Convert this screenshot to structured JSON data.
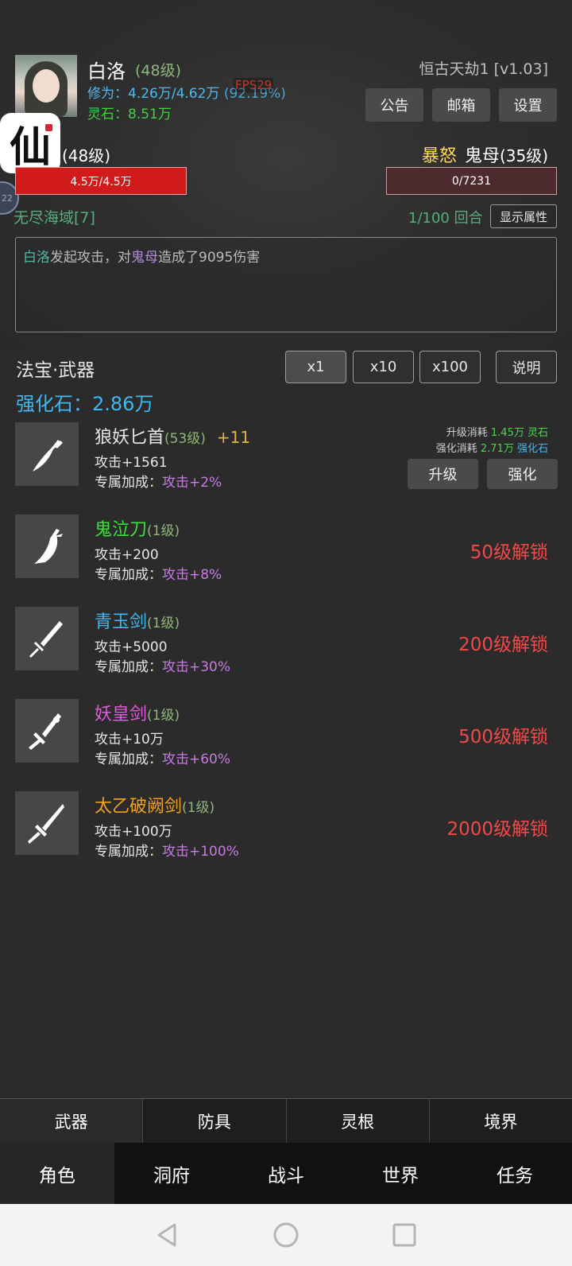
{
  "header": {
    "player_name": "白洛",
    "player_level": "(48级)",
    "cultivation_label": "修为：",
    "cultivation_value": "4.26万/4.62万",
    "cultivation_pct": "(92.19%)",
    "fps": "FPS29",
    "stone_label": "灵石：",
    "stone_value": "8.51万",
    "game_version": "恒古天劫1 [v1.03]",
    "buttons": {
      "announce": "公告",
      "mail": "邮箱",
      "settings": "设置"
    }
  },
  "overlay": {
    "app_logo_char": "仙",
    "side_bubble": "22"
  },
  "battle": {
    "hero_level": "(48级)",
    "hero_hp": "4.5万/4.5万",
    "hero_hp_fraction": 1.0,
    "enemy_status": "暴怒",
    "enemy_name": "鬼母",
    "enemy_level": "(35级)",
    "enemy_hp": "0/7231",
    "enemy_hp_fraction": 0.0,
    "zone": "无尽海域[7]",
    "round": "1/100 回合",
    "show_attr_button": "显示属性",
    "log": {
      "actor": "白洛",
      "text1": "发起攻击，对",
      "target": "鬼母",
      "text2": "造成了9095伤害"
    }
  },
  "section": {
    "title": "法宝·武器",
    "multipliers": [
      "x1",
      "x10",
      "x100"
    ],
    "active_multiplier": "x1",
    "explain_button": "说明",
    "stone_label": "强化石：",
    "stone_value": "2.86万"
  },
  "weapons": [
    {
      "name": "狼妖匕首",
      "level": "(53级)",
      "enhance": "+11",
      "attack": "攻击+1561",
      "bonus_label": "专属加成：",
      "bonus_value": "攻击+2%",
      "name_color": "#e6e6e6",
      "icon": "dagger-icon",
      "upgrade_cost_label": "升级消耗",
      "upgrade_cost": "1.45万",
      "upgrade_unit": "灵石",
      "enhance_cost_label": "强化消耗",
      "enhance_cost": "2.71万",
      "enhance_unit": "强化石",
      "upgrade_button": "升级",
      "enhance_button": "强化"
    },
    {
      "name": "鬼泣刀",
      "level": "(1级)",
      "attack": "攻击+200",
      "bonus_label": "专属加成：",
      "bonus_value": "攻击+8%",
      "unlock": "50级解锁",
      "name_color": "#3ee03e",
      "icon": "saber-icon"
    },
    {
      "name": "青玉剑",
      "level": "(1级)",
      "attack": "攻击+5000",
      "bonus_label": "专属加成：",
      "bonus_value": "攻击+30%",
      "unlock": "200级解锁",
      "name_color": "#3fb7f0",
      "icon": "sword-icon"
    },
    {
      "name": "妖皇剑",
      "level": "(1级)",
      "attack": "攻击+10万",
      "bonus_label": "专属加成：",
      "bonus_value": "攻击+60%",
      "unlock": "500级解锁",
      "name_color": "#e05ad8",
      "icon": "ornate-sword-icon"
    },
    {
      "name": "太乙破阙剑",
      "level": "(1级)",
      "attack": "攻击+100万",
      "bonus_label": "专属加成：",
      "bonus_value": "攻击+100%",
      "unlock": "2000级解锁",
      "name_color": "#f0a020",
      "icon": "long-sword-icon"
    }
  ],
  "subtabs": [
    "武器",
    "防具",
    "灵根",
    "境界"
  ],
  "active_subtab": "武器",
  "maintabs": [
    "角色",
    "洞府",
    "战斗",
    "世界",
    "任务"
  ],
  "active_maintab": "角色",
  "colors": {
    "background": "#2b2b2b",
    "hp_red": "#d11b1b",
    "unlock_red": "#ef4a4a",
    "accent_blue": "#3fb7f0"
  }
}
